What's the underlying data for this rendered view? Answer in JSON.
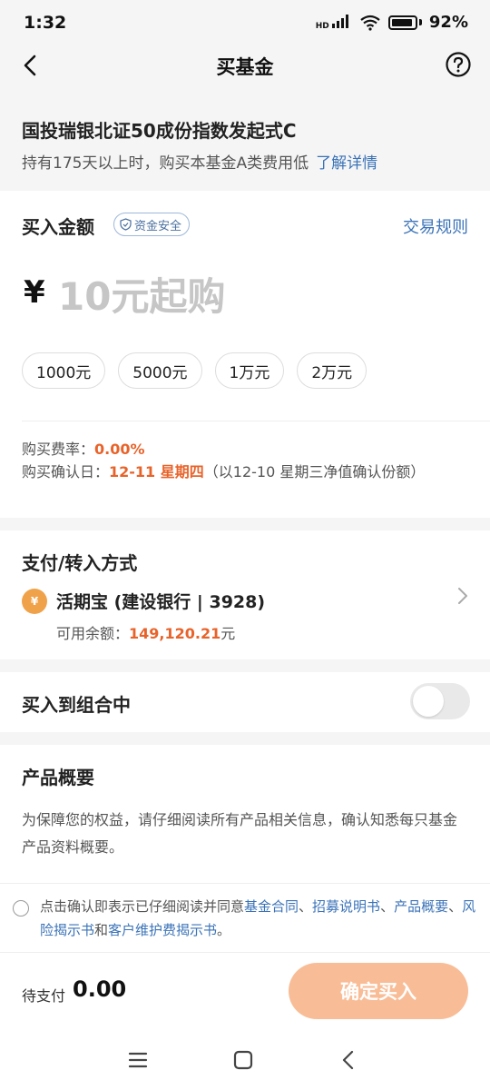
{
  "status_bar": {
    "time": "1:32",
    "signal_tag": "HD",
    "battery": "92%"
  },
  "nav": {
    "title": "买基金"
  },
  "fund": {
    "name": "国投瑞银北证50成份指数发起式C",
    "note": "持有175天以上时，购买本基金A类费用低",
    "note_link": "了解详情"
  },
  "amount": {
    "title": "买入金额",
    "safe_badge": "资金安全",
    "rules_link": "交易规则",
    "currency": "¥",
    "placeholder": "10元起购",
    "value": "",
    "quick_options": [
      "1000元",
      "5000元",
      "1万元",
      "2万元"
    ],
    "fee_label": "购买费率：",
    "fee_value": "0.00%",
    "confirm_label": "购买确认日：",
    "confirm_value": "12-11 星期四",
    "confirm_note": "（以12-10 星期三净值确认份额）"
  },
  "payment": {
    "title": "支付/转入方式",
    "icon_glyph": "¥",
    "method": "活期宝 (建设银行 | 3928)",
    "balance_label": "可用余额：",
    "balance_value": "149,120.21",
    "balance_unit": "元"
  },
  "combo": {
    "label": "买入到组合中",
    "enabled": false
  },
  "overview": {
    "title": "产品概要",
    "desc": "为保障您的权益，请仔细阅读所有产品相关信息，确认知悉每只基金产品资料概要。"
  },
  "agreement": {
    "checked": false,
    "prefix": "点击确认即表示已仔细阅读并同意",
    "link1": "基金合同",
    "sep1": "、",
    "link2": "招募说明书",
    "sep2": "、",
    "link3": "产品概要",
    "sep3": "、",
    "link4": "风险揭示书",
    "and": "和",
    "link5": "客户维护费揭示书",
    "end": "。"
  },
  "bottom": {
    "pay_label": "待支付",
    "pay_amount": "0.00",
    "confirm_button": "确定买入"
  },
  "colors": {
    "accent_orange": "#e8632a",
    "link_blue": "#3b73b8",
    "button_disabled": "#f8bd97"
  }
}
